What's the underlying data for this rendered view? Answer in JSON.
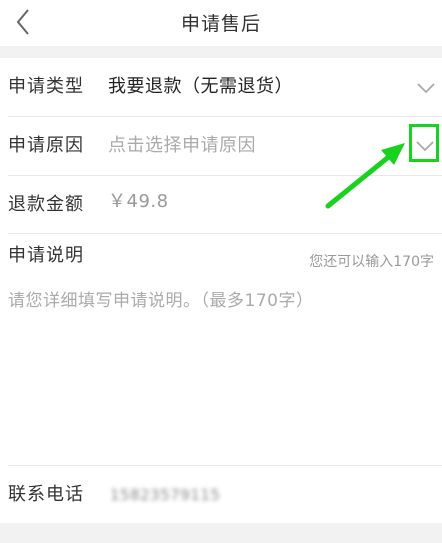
{
  "header": {
    "title": "申请售后"
  },
  "form": {
    "type": {
      "label": "申请类型",
      "value": "我要退款（无需退货）"
    },
    "reason": {
      "label": "申请原因",
      "placeholder": "点击选择申请原因"
    },
    "amount": {
      "label": "退款金额",
      "value": "￥49.8"
    },
    "description": {
      "label": "申请说明",
      "counter": "您还可以输入170字",
      "placeholder": "请您详细填写申请说明。（最多170字）"
    },
    "phone": {
      "label": "联系电话",
      "value": "15823579115"
    }
  },
  "annotation": {
    "color": "#19d11f"
  }
}
